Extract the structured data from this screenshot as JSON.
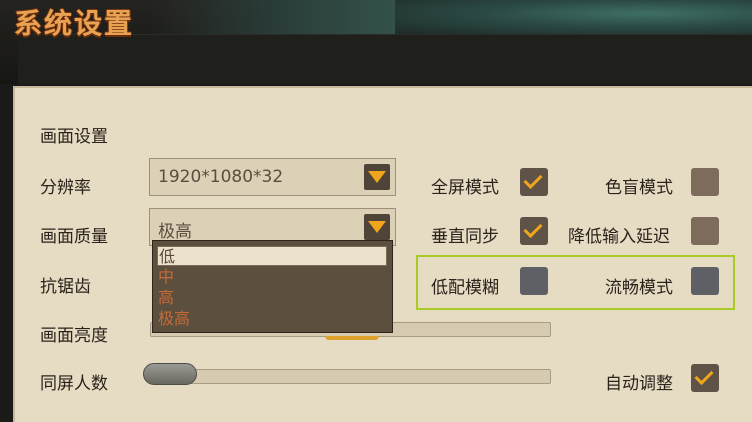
{
  "window": {
    "title": "系统设置"
  },
  "section": {
    "title": "画面设置"
  },
  "settings": {
    "resolution": {
      "label": "分辨率",
      "value": "1920*1080*32"
    },
    "quality": {
      "label": "画面质量",
      "value": "极高",
      "options": [
        "低",
        "中",
        "高",
        "极高"
      ],
      "highlighted_option": "低"
    },
    "antialias": {
      "label": "抗锯齿"
    },
    "brightness": {
      "label": "画面亮度"
    },
    "same_screen_players": {
      "label": "同屏人数",
      "level": 0.0
    }
  },
  "toggles": {
    "fullscreen": {
      "label": "全屏模式",
      "checked": true
    },
    "colorblind": {
      "label": "色盲模式",
      "checked": false
    },
    "vsync": {
      "label": "垂直同步",
      "checked": true
    },
    "low_latency": {
      "label": "降低输入延迟",
      "checked": false
    },
    "low_blur": {
      "label": "低配模糊",
      "checked": false
    },
    "smooth_mode": {
      "label": "流畅模式",
      "checked": false
    },
    "auto_adjust": {
      "label": "自动调整",
      "checked": true
    }
  },
  "colors": {
    "accent": "#f0a51c",
    "highlight_border": "#a8cc24",
    "parchment": "#e6dbc3"
  }
}
